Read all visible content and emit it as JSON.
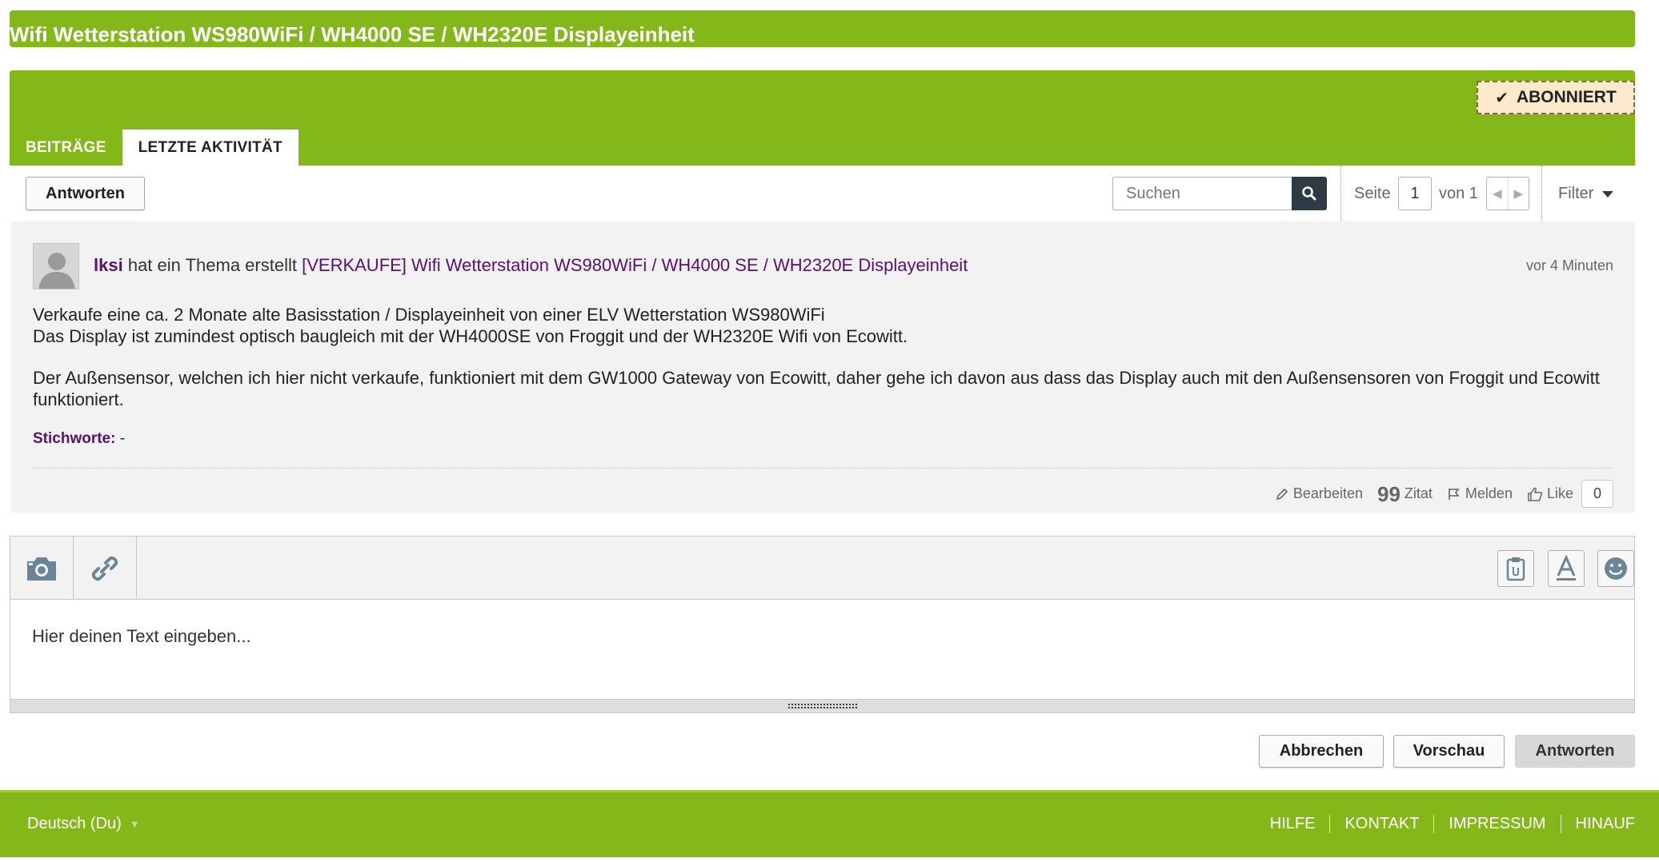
{
  "thread": {
    "title": "Wifi Wetterstation WS980WiFi / WH4000 SE / WH2320E Displayeinheit",
    "subscribe_label": "ABONNIERT"
  },
  "tabs": [
    {
      "label": "BEITRÄGE",
      "active": false
    },
    {
      "label": "LETZTE AKTIVITÄT",
      "active": true
    }
  ],
  "toolbar": {
    "reply_label": "Antworten",
    "search_placeholder": "Suchen",
    "page_label": "Seite",
    "page_current": "1",
    "page_of": "von 1",
    "filter_label": "Filter"
  },
  "post": {
    "author": "lksi",
    "action_text": "hat ein Thema erstellt",
    "thread_link": "[VERKAUFE] Wifi Wetterstation WS980WiFi / WH4000 SE / WH2320E Displayeinheit",
    "time": "vor 4 Minuten",
    "body": [
      "Verkaufe eine ca. 2 Monate alte Basisstation / Displayeinheit von einer ELV Wetterstation WS980WiFi",
      "Das Display ist zumindest optisch baugleich mit der WH4000SE von Froggit und der WH2320E Wifi von Ecowitt.",
      "Der Außensensor, welchen ich hier nicht verkaufe, funktioniert mit dem GW1000 Gateway von Ecowitt, daher gehe ich davon aus dass das Display auch mit den Außensensoren von Froggit und Ecowitt funktioniert."
    ],
    "tags_label": "Stichworte:",
    "tags_value": "-",
    "actions": {
      "edit": "Bearbeiten",
      "quote": "Zitat",
      "report": "Melden",
      "like": "Like",
      "like_count": "0"
    }
  },
  "editor": {
    "placeholder": "Hier deinen Text eingeben...",
    "cancel_label": "Abbrechen",
    "preview_label": "Vorschau",
    "submit_label": "Antworten"
  },
  "footer": {
    "language": "Deutsch (Du)",
    "links": [
      "HILFE",
      "KONTAKT",
      "IMPRESSUM",
      "HINAUF"
    ]
  },
  "colors": {
    "brand_green": "#84b81a",
    "link_purple": "#5a1070",
    "subscribe_bg": "#fde9cc"
  },
  "icons": {
    "subscribe": "checkmark-icon",
    "search": "search-icon",
    "camera": "camera-icon",
    "link": "link-icon",
    "clipboard": "clipboard-icon",
    "text_format": "text-format-icon",
    "emoji": "smiley-icon"
  }
}
